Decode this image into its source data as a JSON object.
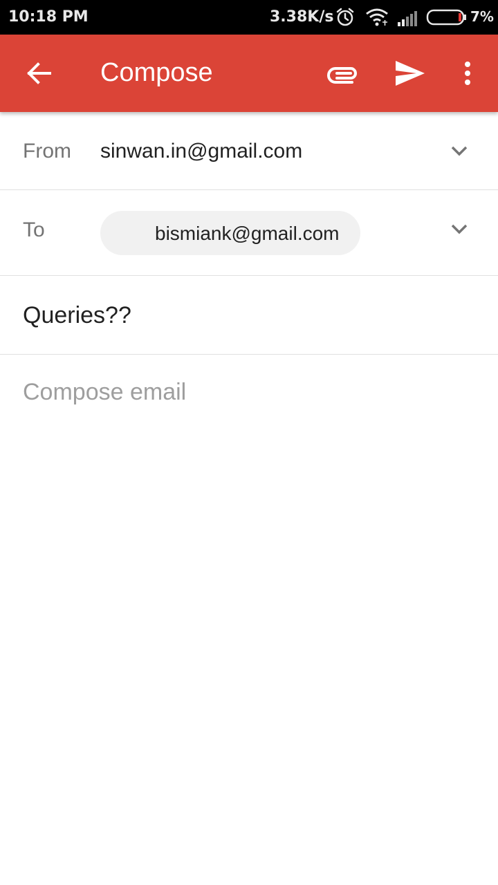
{
  "status_bar": {
    "time": "10:18 PM",
    "net_speed": "3.38K/s",
    "icons": [
      "alarm-icon",
      "wifi-icon",
      "signal-icon",
      "battery-icon"
    ],
    "battery_percent": "7%"
  },
  "app_bar": {
    "title": "Compose",
    "background": "#db4437",
    "actions": [
      "back-arrow-icon",
      "attach-icon",
      "send-icon",
      "more-vert-icon"
    ]
  },
  "from": {
    "label": "From",
    "value": "sinwan.in@gmail.com"
  },
  "to": {
    "label": "To",
    "recipient": "bismiank@gmail.com"
  },
  "subject": {
    "value": "Queries??"
  },
  "body": {
    "placeholder": "Compose email",
    "value": ""
  }
}
